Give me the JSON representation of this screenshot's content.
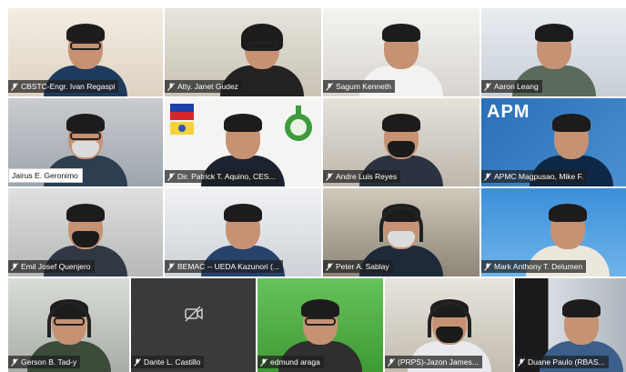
{
  "meeting": {
    "participants": [
      {
        "name": "CBSTC-Engr. Ivan Regaspi",
        "muted": true
      },
      {
        "name": "Atty. Janet Gudez",
        "muted": true
      },
      {
        "name": "Sagum Kenneth",
        "muted": true
      },
      {
        "name": "Aaron Leang",
        "muted": true
      },
      {
        "name": "Jairus E. Geronimo",
        "muted": false
      },
      {
        "name": "Dir. Patrick T. Aquino, CES...",
        "muted": true
      },
      {
        "name": "Andre Luis Reyes",
        "muted": true
      },
      {
        "name": "APMC Magpusao, Mike F.",
        "muted": true
      },
      {
        "name": "Emil Josef Quenjero",
        "muted": true
      },
      {
        "name": "BEMAC -- UEDA Kazunori (...",
        "muted": true
      },
      {
        "name": "Peter A. Sablay",
        "muted": true
      },
      {
        "name": "Mark Anthony T. Delumen",
        "muted": true
      },
      {
        "name": "Gerson B. Tad-y",
        "muted": true
      },
      {
        "name": "Dante L. Castillo",
        "muted": true,
        "camera_off": true
      },
      {
        "name": "edmund araga",
        "muted": true
      },
      {
        "name": "(PRPS)-Jazon James...",
        "muted": true
      },
      {
        "name": "Duane Paulo (RBAS...",
        "muted": true
      }
    ],
    "background_logo_text": "APM"
  },
  "colors": {
    "name_tag_bg": "#1e1e1e",
    "name_tag_text": "#ffffff",
    "tile_bg": "#444444"
  },
  "icons": {
    "muted": "microphone-muted-icon",
    "camera_off": "camera-off-icon"
  }
}
